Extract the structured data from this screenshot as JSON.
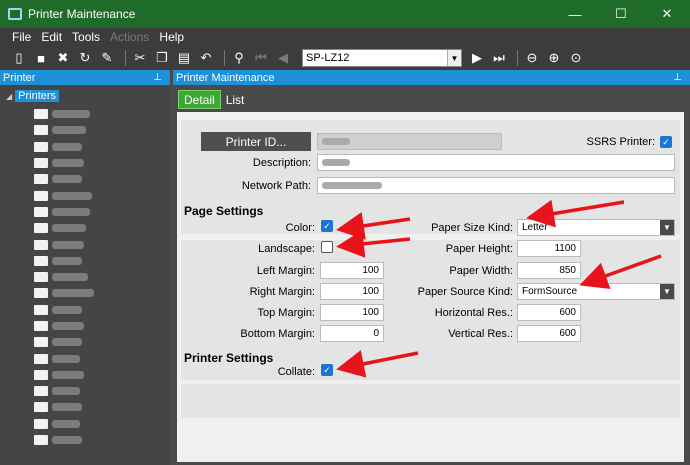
{
  "window": {
    "title": "Printer Maintenance",
    "controls": [
      "—",
      "☐",
      "✕"
    ]
  },
  "menu": {
    "items": [
      "File",
      "Edit",
      "Tools",
      "Actions",
      "Help"
    ]
  },
  "toolbar": {
    "record_value": "SP-LZ12"
  },
  "tree_panel": {
    "title": "Printers_header",
    "header_label": "Printer",
    "root_label": "Printers",
    "item_count": 21
  },
  "main_panel": {
    "header_label": "Printer Maintenance",
    "tabs": [
      "Detail",
      "List"
    ]
  },
  "form": {
    "printer_id_button": "Printer ID...",
    "ssrs_label": "SSRS Printer:",
    "ssrs_checked": true,
    "description_label": "Description:",
    "network_path_label": "Network Path:",
    "page_settings_title": "Page Settings",
    "color_label": "Color:",
    "color_checked": true,
    "landscape_label": "Landscape:",
    "landscape_checked": false,
    "left_margin_label": "Left Margin:",
    "left_margin": "100",
    "right_margin_label": "Right Margin:",
    "right_margin": "100",
    "top_margin_label": "Top Margin:",
    "top_margin": "100",
    "bottom_margin_label": "Bottom Margin:",
    "bottom_margin": "0",
    "paper_size_kind_label": "Paper Size Kind:",
    "paper_size_kind": "Letter",
    "paper_height_label": "Paper Height:",
    "paper_height": "1100",
    "paper_width_label": "Paper Width:",
    "paper_width": "850",
    "paper_source_kind_label": "Paper Source Kind:",
    "paper_source_kind": "FormSource",
    "horizontal_res_label": "Horizontal Res.:",
    "horizontal_res": "600",
    "vertical_res_label": "Vertical Res.:",
    "vertical_res": "600",
    "printer_settings_title": "Printer Settings",
    "collate_label": "Collate:",
    "collate_checked": true
  },
  "colors": {
    "titlebar": "#1f6b2a",
    "accent_blue": "#1e90d8",
    "tab_green": "#3fa535",
    "arrow_red": "#e8141b"
  }
}
